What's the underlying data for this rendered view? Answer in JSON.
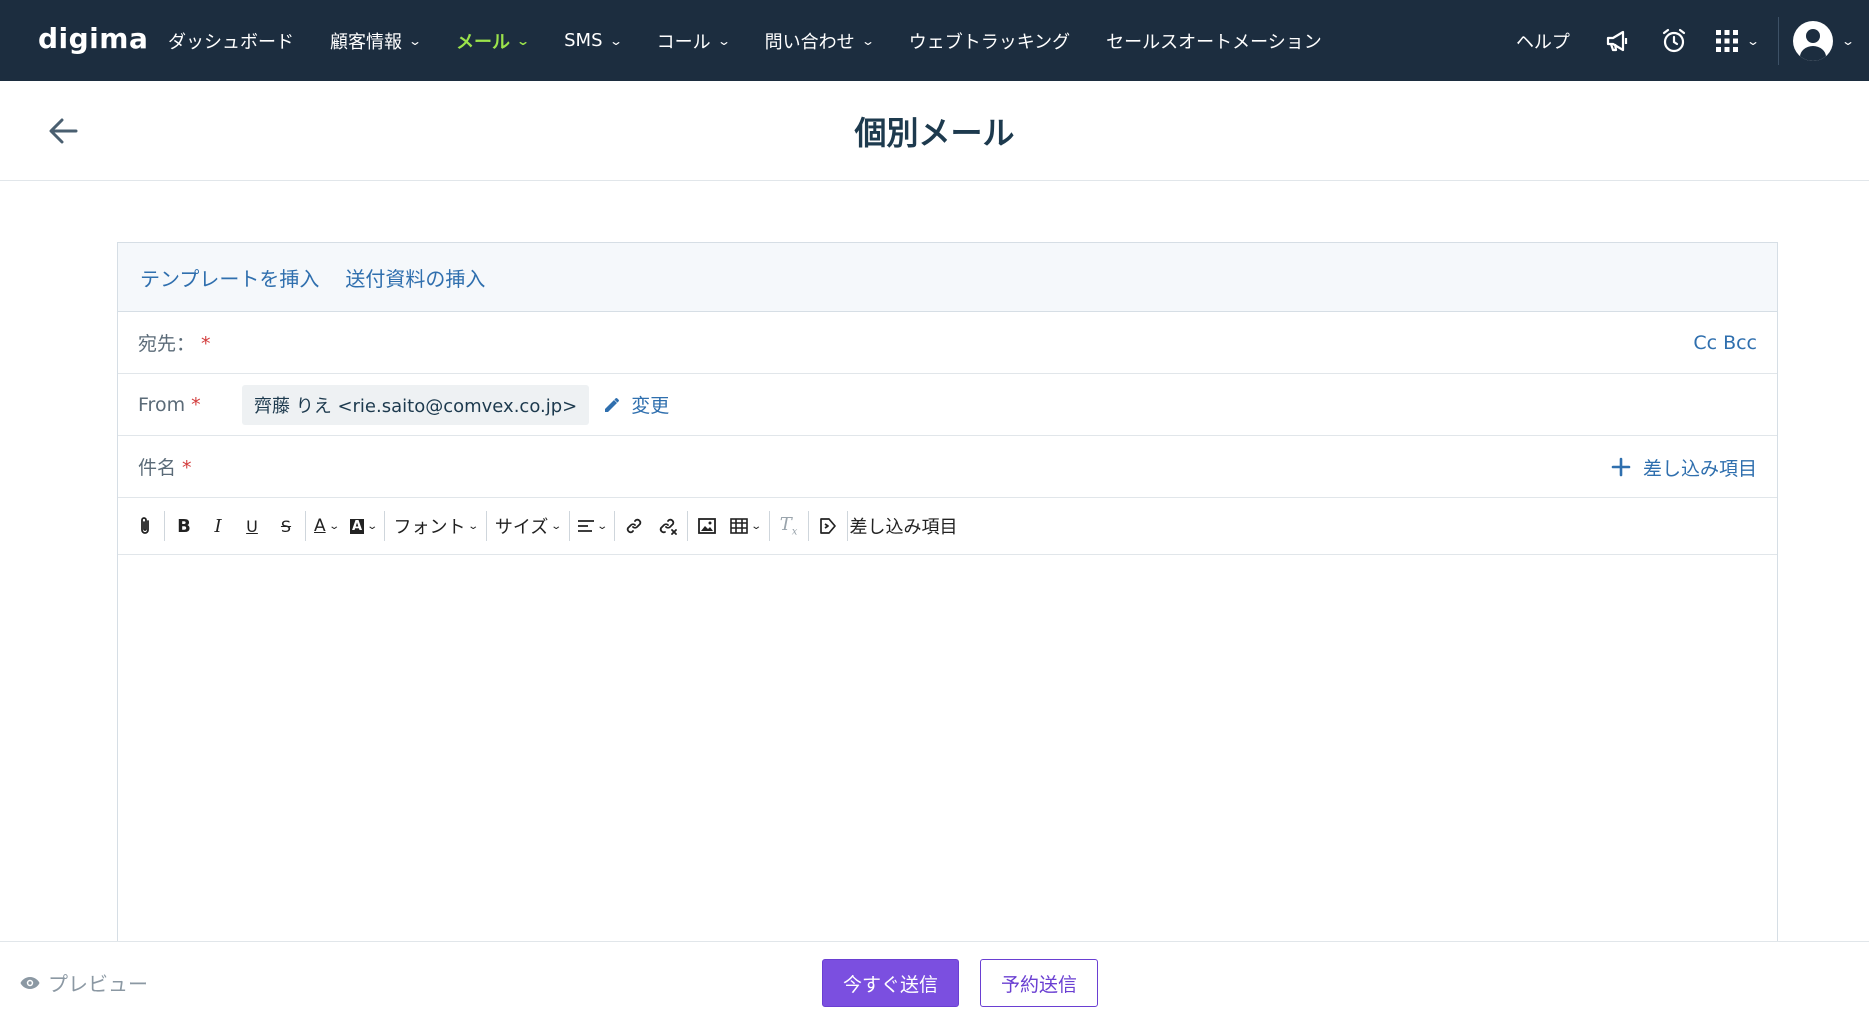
{
  "brand": {
    "logo_text": "digima",
    "accent": "#9be34b",
    "nav_bg": "#1c2d3f",
    "link": "#2f6fae",
    "primary": "#7b4fe0"
  },
  "nav": {
    "items": [
      {
        "label": "ダッシュボード",
        "dropdown": false
      },
      {
        "label": "顧客情報",
        "dropdown": true
      },
      {
        "label": "メール",
        "dropdown": true,
        "active": true
      },
      {
        "label": "SMS",
        "dropdown": true
      },
      {
        "label": "コール",
        "dropdown": true
      },
      {
        "label": "問い合わせ",
        "dropdown": true
      },
      {
        "label": "ウェブトラッキング",
        "dropdown": false
      },
      {
        "label": "セールスオートメーション",
        "dropdown": false
      }
    ],
    "help": "ヘルプ",
    "icons": [
      "megaphone-icon",
      "alarm-clock-icon",
      "app-grid-icon",
      "user-avatar-icon"
    ]
  },
  "page": {
    "title": "個別メール"
  },
  "compose": {
    "insert_template": "テンプレートを挿入",
    "insert_material": "送付資料の挿入",
    "to_label": "宛先：",
    "required_mark": "*",
    "cc_bcc": "Cc Bcc",
    "from_label": "From",
    "from_value": "齊藤 りえ <rie.saito@comvex.co.jp>",
    "change": "変更",
    "subject_label": "件名",
    "merge_fields": "差し込み項目"
  },
  "toolbar": {
    "font": "フォント",
    "size": "サイズ",
    "merge_fields": "差し込み項目"
  },
  "footer": {
    "preview": "プレビュー",
    "send_now": "今すぐ送信",
    "schedule_send": "予約送信"
  }
}
